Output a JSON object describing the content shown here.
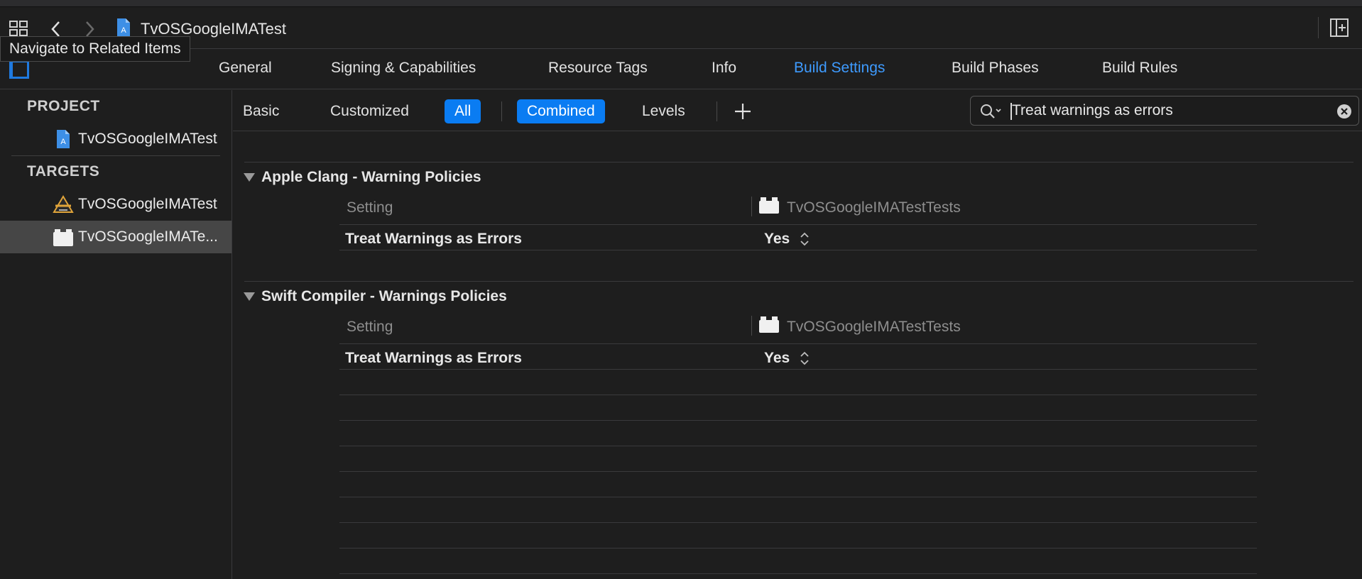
{
  "jump_bar": {
    "title": "TvOSGoogleIMATest",
    "tooltip": "Navigate to Related Items"
  },
  "tabs": [
    {
      "label": "General",
      "active": false
    },
    {
      "label": "Signing & Capabilities",
      "active": false
    },
    {
      "label": "Resource Tags",
      "active": false
    },
    {
      "label": "Info",
      "active": false
    },
    {
      "label": "Build Settings",
      "active": true
    },
    {
      "label": "Build Phases",
      "active": false
    },
    {
      "label": "Build Rules",
      "active": false
    }
  ],
  "sidebar": {
    "project_header": "PROJECT",
    "project_item": "TvOSGoogleIMATest",
    "targets_header": "TARGETS",
    "targets": [
      {
        "label": "TvOSGoogleIMATest",
        "icon": "app-target-icon",
        "selected": false
      },
      {
        "label": "TvOSGoogleIMATe...",
        "icon": "test-bundle-icon",
        "selected": true
      }
    ]
  },
  "filter": {
    "scope_buttons": [
      {
        "label": "Basic",
        "selected": false
      },
      {
        "label": "Customized",
        "selected": false
      },
      {
        "label": "All",
        "selected": true
      }
    ],
    "view_buttons": [
      {
        "label": "Combined",
        "selected": true
      },
      {
        "label": "Levels",
        "selected": false
      }
    ],
    "search_value": "Treat warnings as errors"
  },
  "sections": [
    {
      "title": "Apple Clang - Warning Policies",
      "column_setting": "Setting",
      "column_target": "TvOSGoogleIMATestTests",
      "rows": [
        {
          "label": "Treat Warnings as Errors",
          "value": "Yes"
        }
      ]
    },
    {
      "title": "Swift Compiler - Warnings Policies",
      "column_setting": "Setting",
      "column_target": "TvOSGoogleIMATestTests",
      "rows": [
        {
          "label": "Treat Warnings as Errors",
          "value": "Yes"
        }
      ]
    }
  ],
  "colors": {
    "accent": "#0a7cf2",
    "active_tab": "#3e9bff",
    "background": "#1e1e1e",
    "selection": "#464646"
  }
}
